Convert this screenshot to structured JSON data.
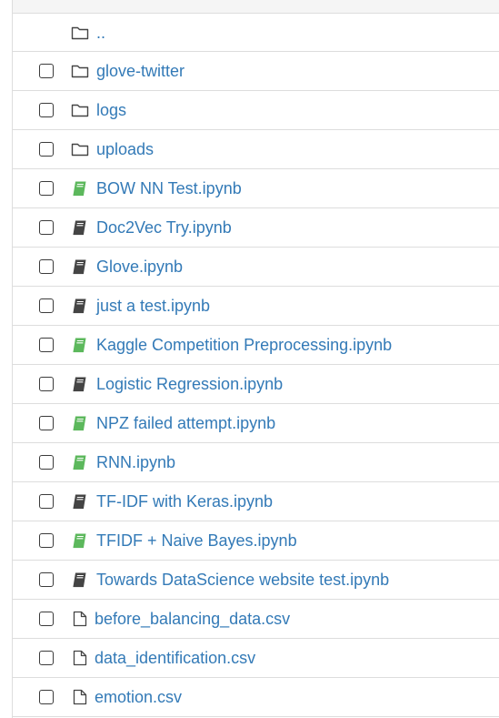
{
  "colors": {
    "link": "#337ab7",
    "running_notebook": "#5cb85c",
    "idle_notebook": "#444444",
    "row_border": "#dddddd"
  },
  "parent_dir": {
    "label": "..",
    "icon": "folder-icon"
  },
  "items": [
    {
      "name": "glove-twitter",
      "kind": "folder",
      "icon": "folder-icon"
    },
    {
      "name": "logs",
      "kind": "folder",
      "icon": "folder-icon"
    },
    {
      "name": "uploads",
      "kind": "folder",
      "icon": "folder-icon"
    },
    {
      "name": "BOW NN Test.ipynb",
      "kind": "notebook",
      "running": true,
      "icon": "notebook-icon"
    },
    {
      "name": "Doc2Vec Try.ipynb",
      "kind": "notebook",
      "running": false,
      "icon": "notebook-icon"
    },
    {
      "name": "Glove.ipynb",
      "kind": "notebook",
      "running": false,
      "icon": "notebook-icon"
    },
    {
      "name": "just a test.ipynb",
      "kind": "notebook",
      "running": false,
      "icon": "notebook-icon"
    },
    {
      "name": "Kaggle Competition Preprocessing.ipynb",
      "kind": "notebook",
      "running": true,
      "icon": "notebook-icon"
    },
    {
      "name": "Logistic Regression.ipynb",
      "kind": "notebook",
      "running": false,
      "icon": "notebook-icon"
    },
    {
      "name": "NPZ failed attempt.ipynb",
      "kind": "notebook",
      "running": true,
      "icon": "notebook-icon"
    },
    {
      "name": "RNN.ipynb",
      "kind": "notebook",
      "running": true,
      "icon": "notebook-icon"
    },
    {
      "name": "TF-IDF with Keras.ipynb",
      "kind": "notebook",
      "running": false,
      "icon": "notebook-icon"
    },
    {
      "name": "TFIDF + Naive Bayes.ipynb",
      "kind": "notebook",
      "running": true,
      "icon": "notebook-icon"
    },
    {
      "name": "Towards DataScience website test.ipynb",
      "kind": "notebook",
      "running": false,
      "icon": "notebook-icon"
    },
    {
      "name": "before_balancing_data.csv",
      "kind": "file",
      "icon": "file-icon"
    },
    {
      "name": "data_identification.csv",
      "kind": "file",
      "icon": "file-icon"
    },
    {
      "name": "emotion.csv",
      "kind": "file",
      "icon": "file-icon"
    }
  ]
}
